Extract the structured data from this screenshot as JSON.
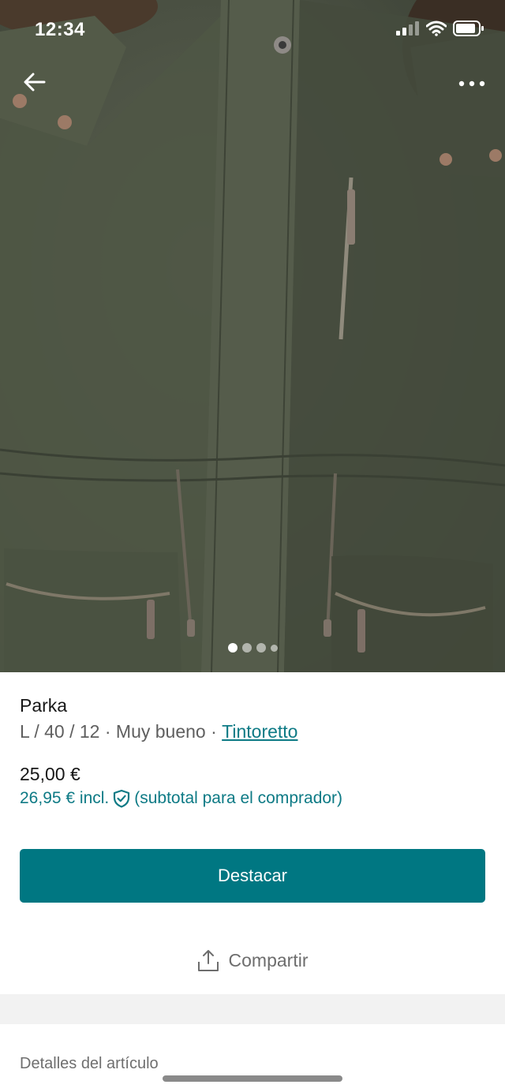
{
  "status_bar": {
    "time": "12:34"
  },
  "nav": {
    "back_icon": "arrow-left-icon",
    "more_icon": "ellipsis-icon"
  },
  "photo": {
    "description_icon": "product-photo",
    "pages_total": 4,
    "active_page": 1
  },
  "item": {
    "title": "Parka",
    "size": "L / 40 / 12",
    "separator": "·",
    "condition": "Muy bueno",
    "brand": "Tintoretto",
    "price": "25,00 €",
    "price_incl": "26,95 € incl.",
    "price_incl_note": "(subtotal para el comprador)"
  },
  "actions": {
    "primary_label": "Destacar",
    "share_label": "Compartir"
  },
  "sections": {
    "details_title": "Detalles del artículo"
  },
  "colors": {
    "accent": "#007782",
    "link": "#0d7a85"
  }
}
